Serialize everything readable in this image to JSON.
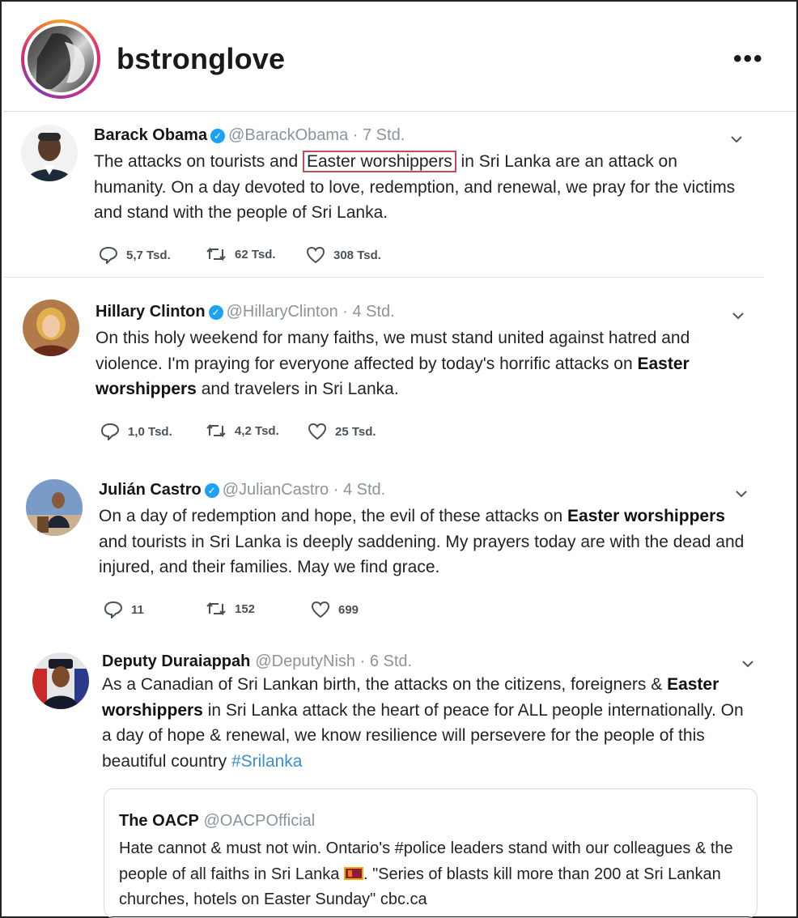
{
  "post": {
    "username": "bstronglove",
    "more_label": "•••"
  },
  "tweets": [
    {
      "name": "Barack Obama",
      "handle": "@BarackObama",
      "time": "7 Std.",
      "text_before": "The attacks on tourists and ",
      "text_boxed": "Easter worshippers",
      "text_after": " in Sri Lanka are an attack on humanity. On a day devoted to love, redemption, and renewal, we pray for the victims and stand with the people of Sri Lanka.",
      "replies": "5,7 Tsd.",
      "retweets": "62 Tsd.",
      "likes": "308 Tsd."
    },
    {
      "name": "Hillary Clinton",
      "handle": "@HillaryClinton",
      "time": "4 Std.",
      "text_before": "On this holy weekend for many faiths, we must stand united against hatred and violence. I'm praying for everyone affected by today's horrific attacks on ",
      "text_bold": "Easter worshippers",
      "text_after": " and travelers in Sri Lanka.",
      "replies": "1,0 Tsd.",
      "retweets": "4,2 Tsd.",
      "likes": "25 Tsd."
    },
    {
      "name": "Julián Castro",
      "handle": "@JulianCastro",
      "time": "4 Std.",
      "text_before": "On a day of redemption and hope, the evil of these attacks on ",
      "text_bold": "Easter worshippers",
      "text_after": " and tourists in Sri Lanka is deeply saddening. My prayers today are with the dead and injured, and their families. May we find grace.",
      "replies": "11",
      "retweets": "152",
      "likes": "699"
    },
    {
      "name": "Deputy Duraiappah",
      "handle": "@DeputyNish",
      "time": "6 Std.",
      "text_before": "As a Canadian of Sri Lankan birth, the attacks on the citizens, foreigners & ",
      "text_bold": "Easter worshippers",
      "text_after": " in Sri Lanka attack the heart of peace for ALL people internationally. On a day of hope & renewal, we know resilience will persevere for the people of this beautiful country ",
      "hashtag": "#Srilanka"
    }
  ],
  "quoted": {
    "name": "The OACP",
    "handle": "@OACPOfficial",
    "text_before": "Hate cannot & must not win. Ontario's #police leaders stand with our colleagues & the people of all faiths in Sri Lanka ",
    "text_after": ". \"Series of blasts kill more than 200 at Sri Lankan churches, hotels on Easter Sunday\" cbc.ca"
  },
  "separator": " · ",
  "verified_mark": "✓",
  "colors": {
    "verified": "#1da1f2",
    "handle": "#8a949c",
    "hashtag": "#3a8fd0",
    "highlight_box": "#c44c5a"
  }
}
